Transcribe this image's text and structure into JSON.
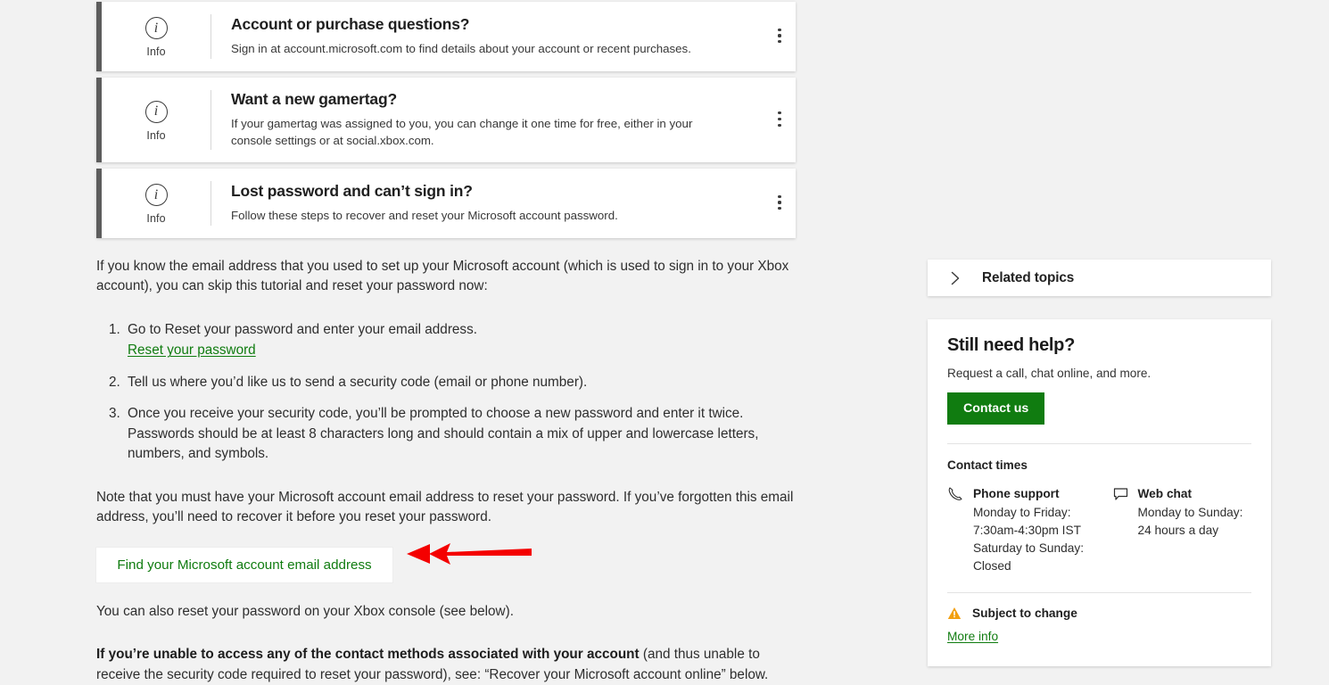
{
  "info_cards": [
    {
      "kind": "Info",
      "icon": "info-circle-icon",
      "title": "Account or purchase questions?",
      "description": "Sign in at account.microsoft.com to find details about your account or recent purchases.",
      "menu_icon": "kebab-menu-icon"
    },
    {
      "kind": "Info",
      "icon": "info-circle-icon",
      "title": "Want a new gamertag?",
      "description": "If your gamertag was assigned to you, you can change it one time for free, either in your console settings or at social.xbox.com.",
      "menu_icon": "kebab-menu-icon"
    },
    {
      "kind": "Info",
      "icon": "info-circle-icon",
      "title": "Lost password and can’t sign in?",
      "description": "Follow these steps to recover and reset your Microsoft account password.",
      "menu_icon": "kebab-menu-icon"
    }
  ],
  "article": {
    "intro": "If you know the email address that you used to set up your Microsoft account (which is used to sign in to your Xbox account), you can skip this tutorial and reset your password now:",
    "steps": [
      "Go to Reset your password and enter your email address.",
      "Tell us where you’d like us to send a security code (email or phone number).",
      "Once you receive your security code, you’ll be prompted to choose a new password and enter it twice. Passwords should be at least 8 characters long and should contain a mix of upper and lowercase letters, numbers, and symbols."
    ],
    "step1_link": "Reset your password",
    "note": "Note that you must have your Microsoft account email address to reset your password. If you’ve forgotten this email address, you’ll need to recover it before you reset your password.",
    "find_button": "Find your Microsoft account email address",
    "console_note": "You can also reset your password on your Xbox console (see below).",
    "bold_lead": "If you’re unable to access any of the contact methods associated with your account",
    "bold_rest": " (and thus unable to receive the security code required to reset your password), see: “Recover your Microsoft account online” below."
  },
  "annotation": {
    "arrow_icon": "red-left-arrow-annotation",
    "color": "#f40000"
  },
  "rail": {
    "related_topics": {
      "label": "Related topics",
      "chevron_icon": "chevron-right-icon"
    },
    "help": {
      "title": "Still need help?",
      "subtitle": "Request a call, chat online, and more.",
      "contact_button": "Contact us",
      "contact_button_color": "#107c10",
      "contact_times_heading": "Contact times",
      "channels": [
        {
          "icon": "phone-icon",
          "name": "Phone support",
          "lines": [
            "Monday to Friday:",
            "7:30am-4:30pm IST",
            "Saturday to Sunday:",
            "Closed"
          ]
        },
        {
          "icon": "chat-bubble-icon",
          "name": "Web chat",
          "lines": [
            "Monday to Sunday:",
            "24 hours a day"
          ]
        }
      ],
      "warning": {
        "icon": "warning-triangle-icon",
        "text": "Subject to change",
        "color": "#f2a010"
      },
      "more_info_link": "More info"
    }
  }
}
